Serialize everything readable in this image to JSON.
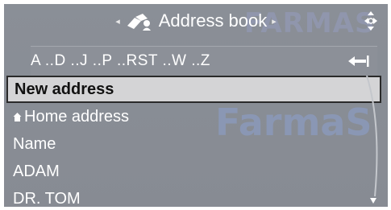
{
  "header": {
    "title": "Address book",
    "left_arrow": "◂",
    "right_arrow": "▸",
    "icon": "address-book-icon",
    "controller_icon": "controller-knob-icon"
  },
  "alphabet": {
    "label": "A ..D ..J ..P ..RST ..W ..Z",
    "back_icon": "back-arrow-icon"
  },
  "list": {
    "items": [
      {
        "label": "New address",
        "selected": true
      },
      {
        "label": "Home address",
        "icon": "home-icon"
      },
      {
        "label": "Name"
      },
      {
        "label": "ADAM"
      },
      {
        "label": "DR. TOM"
      }
    ]
  },
  "watermark": {
    "top": "FARMAS",
    "middle": "FarmaS"
  },
  "colors": {
    "background": "#898d95",
    "text": "#ffffff",
    "selected_bg": "#d4d4d6",
    "selected_border": "#2a2a2a",
    "watermark": "#8ca0cd"
  }
}
